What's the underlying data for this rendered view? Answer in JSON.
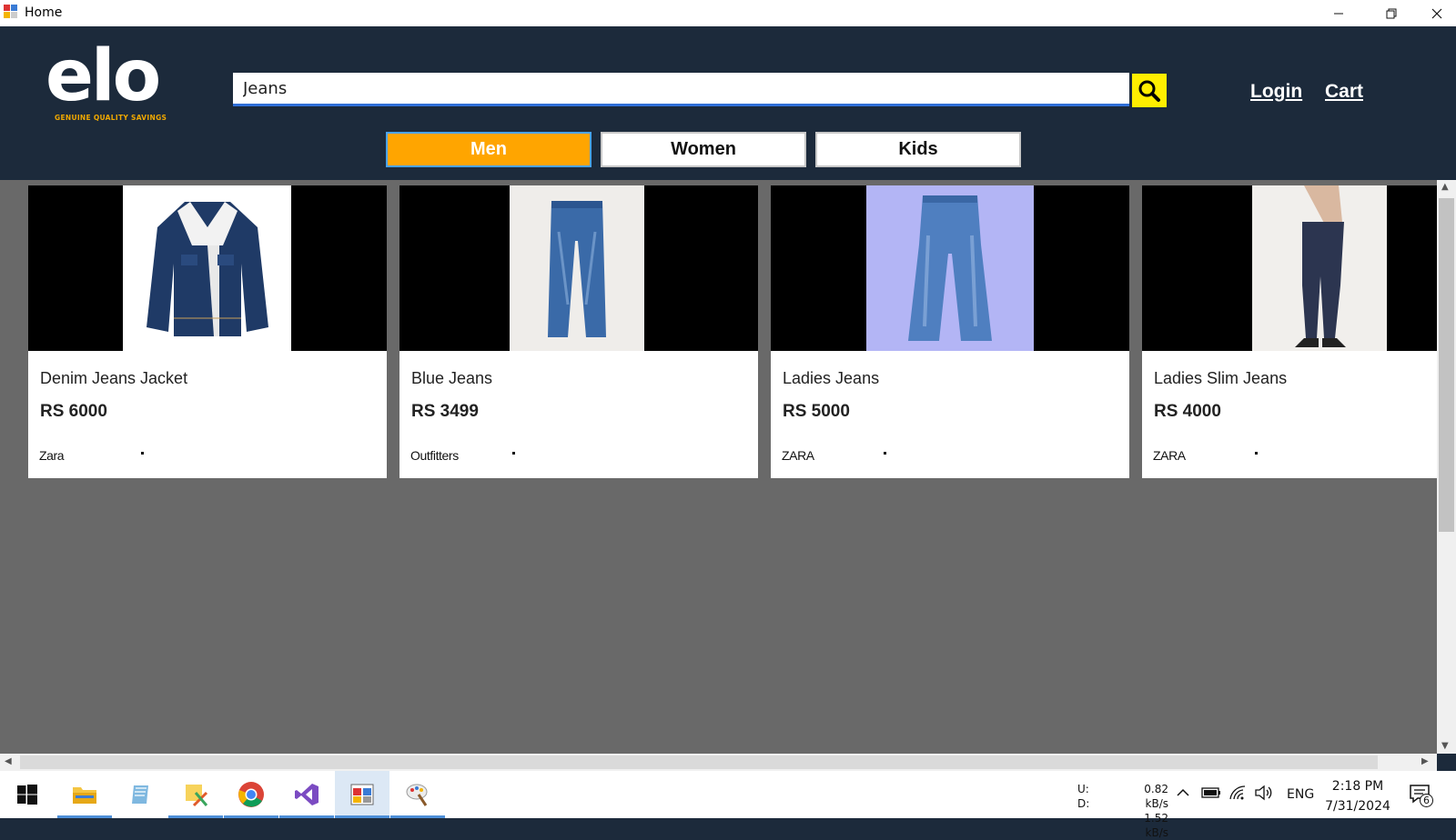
{
  "window": {
    "title": "Home"
  },
  "header": {
    "logo_text": "elo",
    "logo_tagline": "GENUINE QUALITY SAVINGS",
    "search_value": "Jeans",
    "links": {
      "login": "Login",
      "cart": "Cart"
    },
    "categories": [
      "Men",
      "Women",
      "Kids"
    ],
    "active_category": "Men"
  },
  "products": [
    {
      "name": "Denim Jeans Jacket",
      "price": "RS 6000",
      "brand": "Zara",
      "image": "denim-jacket"
    },
    {
      "name": "Blue Jeans",
      "price": "RS 3499",
      "brand": "Outfitters",
      "image": "blue-jeans"
    },
    {
      "name": "Ladies Jeans",
      "price": "RS 5000",
      "brand": "ZARA",
      "image": "ladies-jeans"
    },
    {
      "name": "Ladies Slim Jeans",
      "price": "RS 4000",
      "brand": "ZARA",
      "image": "ladies-slim-jeans"
    }
  ],
  "taskbar": {
    "apps": [
      "start-icon",
      "file-explorer-icon",
      "notepad-icon",
      "snipping-tool-icon",
      "chrome-icon",
      "visual-studio-icon",
      "home-app-icon",
      "paint-icon"
    ],
    "net_up_label": "U:",
    "net_down_label": "D:",
    "net_up": "0.82 kB/s",
    "net_down": "1.52 kB/s",
    "language": "ENG",
    "time": "2:18 PM",
    "date": "7/31/2024",
    "notification_count": "6"
  },
  "colors": {
    "header_bg": "#1c2a3b",
    "accent_orange": "#ffa500",
    "search_button": "#ffee00",
    "content_bg": "#696969"
  }
}
